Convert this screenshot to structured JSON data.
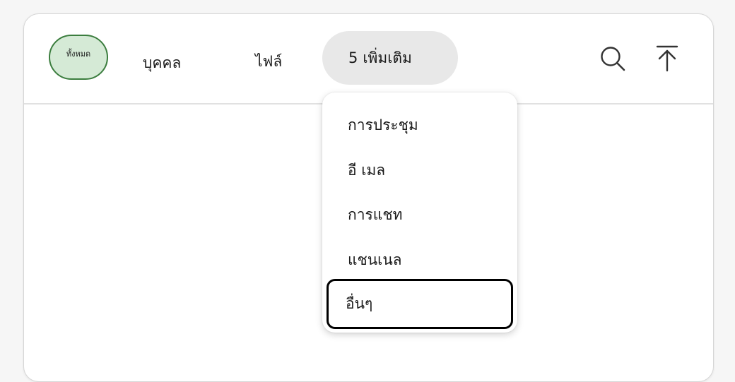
{
  "tabs": {
    "all": "ทั้งหมด",
    "people": "บุคคล",
    "files": "ไฟล์",
    "more_count": "5",
    "more_label": "เพิ่มเติม"
  },
  "toolbar": {
    "search_icon": "search-icon",
    "upload_icon": "upload-icon"
  },
  "more_menu": {
    "items": [
      {
        "label": "การประชุม"
      },
      {
        "label": "อี เมล"
      },
      {
        "label": "การแชท"
      },
      {
        "label": "แชนเนล"
      },
      {
        "label": "อื่นๆ"
      }
    ],
    "focused_index": 4
  },
  "colors": {
    "accent_green": "#3b7d3e",
    "accent_green_fill": "#d5ead6"
  }
}
